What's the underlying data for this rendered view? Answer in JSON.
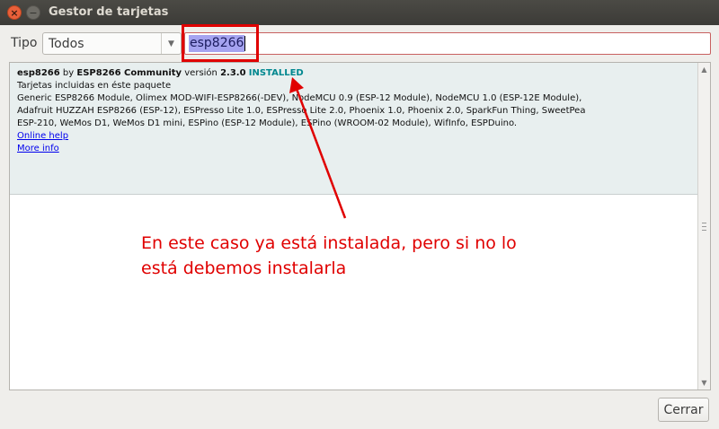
{
  "window": {
    "title": "Gestor de tarjetas",
    "close_glyph": "×",
    "minimize_glyph": "−"
  },
  "filter": {
    "tipo_label": "Tipo",
    "tipo_value": "Todos",
    "search_value": "esp8266"
  },
  "board": {
    "name": "esp8266",
    "by": "by",
    "author": "ESP8266 Community",
    "version_label": "versión",
    "version": "2.3.0",
    "status": "INSTALLED",
    "included_label": "Tarjetas incluidas en éste paquete",
    "boards_line1": "Generic ESP8266 Module, Olimex MOD-WIFI-ESP8266(-DEV), NodeMCU 0.9 (ESP-12 Module), NodeMCU 1.0 (ESP-12E Module),",
    "boards_line2": "Adafruit HUZZAH ESP8266 (ESP-12), ESPresso Lite 1.0, ESPresso Lite 2.0, Phoenix 1.0, Phoenix 2.0, SparkFun Thing, SweetPea",
    "boards_line3": "ESP-210, WeMos D1, WeMos D1 mini, ESPino (ESP-12 Module), ESPino (WROOM-02 Module), WifInfo, ESPDuino.",
    "online_help": "Online help",
    "more_info": "More info"
  },
  "annotation": {
    "line1": "En este caso ya está instalada, pero si no lo",
    "line2": "está debemos instalarla"
  },
  "footer": {
    "close_label": "Cerrar"
  },
  "colors": {
    "annotation": "#e00000",
    "installed": "#00878f",
    "board_bg": "#e8efef",
    "titlebar": "#3c3b37"
  },
  "icons": {
    "dropdown": "chevron-down-icon",
    "scroll_up": "arrow-up-icon",
    "scroll_down": "arrow-down-icon"
  }
}
